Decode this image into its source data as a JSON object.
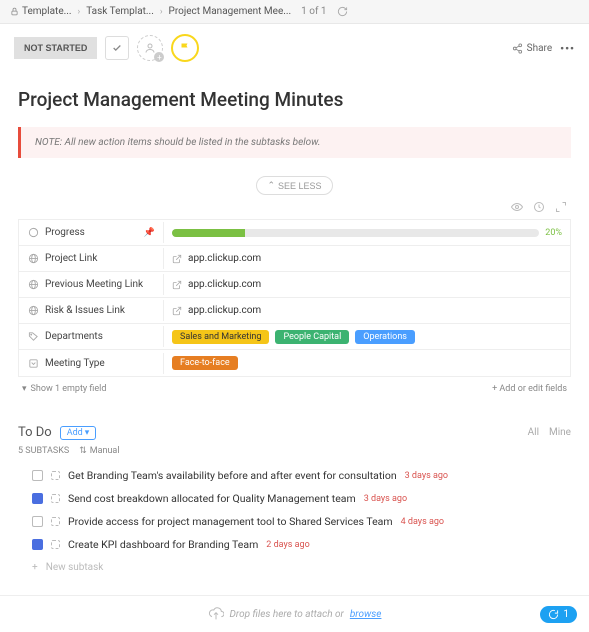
{
  "breadcrumbs": {
    "items": [
      "Template...",
      "Task Templat...",
      "Project Management Mee..."
    ],
    "count": "1 of 1"
  },
  "toolbar": {
    "status": "NOT STARTED",
    "share": "Share"
  },
  "page": {
    "title": "Project Management Meeting Minutes",
    "note": "NOTE: All new action items should be listed in the subtasks below.",
    "see_less": "SEE LESS"
  },
  "fields": [
    {
      "icon": "progress",
      "label": "Progress",
      "pinned": true,
      "type": "progress",
      "value": 20
    },
    {
      "icon": "link",
      "label": "Project Link",
      "type": "link",
      "value": "app.clickup.com"
    },
    {
      "icon": "link",
      "label": "Previous Meeting Link",
      "type": "link",
      "value": "app.clickup.com"
    },
    {
      "icon": "link",
      "label": "Risk & Issues Link",
      "type": "link",
      "value": "app.clickup.com"
    },
    {
      "icon": "tag",
      "label": "Departments",
      "type": "tags",
      "tags": [
        {
          "text": "Sales and Marketing",
          "cls": "tag-yellow"
        },
        {
          "text": "People Capital",
          "cls": "tag-green"
        },
        {
          "text": "Operations",
          "cls": "tag-blue"
        }
      ]
    },
    {
      "icon": "dropdown",
      "label": "Meeting Type",
      "type": "tags",
      "tags": [
        {
          "text": "Face-to-face",
          "cls": "tag-orange"
        }
      ]
    }
  ],
  "field_footer": {
    "show_empty": "Show 1 empty field",
    "add_fields": "+ Add or edit fields"
  },
  "todo": {
    "title": "To Do",
    "add": "Add",
    "filter_all": "All",
    "filter_mine": "Mine",
    "subtasks_label": "5 SUBTASKS",
    "sort": "Manual"
  },
  "tasks": [
    {
      "done": false,
      "title": "Get Branding Team's availability before and after event for consultation",
      "date": "3 days ago"
    },
    {
      "done": true,
      "title": "Send cost breakdown allocated for Quality Management team",
      "date": "3 days ago"
    },
    {
      "done": false,
      "title": "Provide access for project management tool to Shared Services Team",
      "date": "4 days ago"
    },
    {
      "done": true,
      "title": "Create KPI dashboard for Branding Team",
      "date": "2 days ago"
    }
  ],
  "new_task": "New subtask",
  "footer": {
    "text": "Drop files here to attach or ",
    "browse": "browse",
    "clip_count": "1"
  }
}
